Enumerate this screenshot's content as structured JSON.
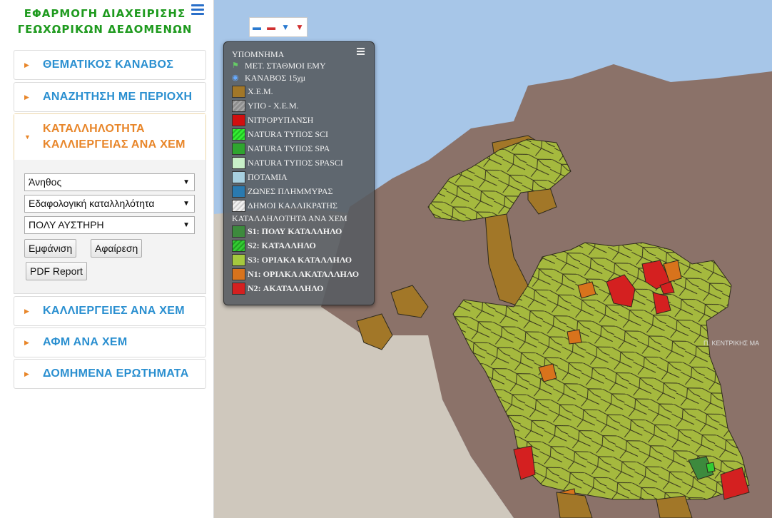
{
  "sidebar": {
    "title_line1": "ΕΦΑΡΜΟΓΗ ΔΙΑΧΕΙΡΙΣΗΣ",
    "title_line2": "ΓΕΩΧΩΡΙΚΩΝ ΔΕΔΟΜΕΝΩΝ",
    "menu_icon": "hamburger-icon",
    "panels": [
      {
        "label": "ΘΕΜΑΤΙΚΟΣ ΚΑΝΑΒΟΣ"
      },
      {
        "label": "ΑΝΑΖΗΤΗΣΗ ΜΕ ΠΕΡΙΟΧΗ"
      },
      {
        "label_line1": "ΚΑΤΑΛΛΗΛΟΤΗΤΑ",
        "label_line2": "ΚΑΛΛΙΕΡΓΕΙΑΣ ΑΝΑ ΧΕΜ"
      },
      {
        "label": "ΚΑΛΛΙΕΡΓΕΙΕΣ ΑΝΑ ΧΕΜ"
      },
      {
        "label": "ΑΦΜ ΑΝΑ ΧΕΜ"
      },
      {
        "label": "ΔΟΜΗΜΕΝΑ ΕΡΩΤΗΜΑΤΑ"
      }
    ],
    "form": {
      "crop_select": "Άνηθος",
      "suitability_select": "Εδαφολογική καταλληλότητα",
      "strictness_select": "ΠΟΛΥ ΑΥΣΤΗΡΗ",
      "show_button": "Εμφάνιση",
      "remove_button": "Αφαίρεση",
      "pdf_button": "PDF Report"
    }
  },
  "map": {
    "region_label": "Π. ΚΕΝΤΡΙΚΗΣ ΜΑ",
    "tools": [
      "zoom-in-icon",
      "zoom-out-icon",
      "filter-icon",
      "clear-filter-icon"
    ],
    "colors": {
      "sea": "#a7c6e8",
      "land_other": "#cfc8bd",
      "region": "#8b7269",
      "s3": "#a5b93e",
      "n1": "#d8731c",
      "n2": "#d42020",
      "xem": "#a27728",
      "s1": "#3d8a3d",
      "s2": "#33cc33"
    }
  },
  "legend": {
    "title": "ΥΠΟΜΝΗΜΑ",
    "items": [
      {
        "label": "ΜΕΤ. ΣΤΑΘΜΟΙ ΕΜΥ",
        "icon": "flag-icon"
      },
      {
        "label": "ΚΑΝΑΒΟΣ 15χμ",
        "icon": "grid-marker-icon"
      },
      {
        "label": "Χ.Ε.Μ.",
        "color": "#a27728"
      },
      {
        "label": "ΥΠΟ - Χ.Ε.Μ.",
        "color": "#8e8e8e"
      },
      {
        "label": "ΝΙΤΡΟΡΥΠΑΝΣΗ",
        "color": "#d10f0f"
      },
      {
        "label": "NATURA ΤΥΠΟΣ SCI",
        "color": "#33ee33"
      },
      {
        "label": "NATURA ΤΥΠΟΣ SPA",
        "color": "#2fa52f"
      },
      {
        "label": "NATURA ΤΥΠΟΣ SPASCI",
        "color": "#c8f0c8"
      },
      {
        "label": "ΠΟΤΑΜΙΑ",
        "color": "#a8d0e0"
      },
      {
        "label": "ΖΩΝΕΣ ΠΛΗΜΜΥΡΑΣ",
        "color": "#2a7ab0"
      },
      {
        "label": "ΔΗΜΟΙ ΚΑΛΛΙΚΡΑΤΗΣ",
        "color": "#e8e8e8"
      }
    ],
    "suitability_title": "ΚΑΤΑΛΛΗΛΟΤΗΤΑ ΑΝΑ ΧΕΜ",
    "suitability": [
      {
        "label": "S1: ΠΟΛΥ ΚΑΤΑΛΛΗΛΟ",
        "color": "#3d8a3d"
      },
      {
        "label": "S2: ΚΑΤΑΛΛΗΛΟ",
        "color": "#33cc33"
      },
      {
        "label": "S3: ΟΡΙΑΚΑ ΚΑΤΑΛΛΗΛΟ",
        "color": "#a5b93e"
      },
      {
        "label": "N1: ΟΡΙΑΚΑ ΑΚΑΤΑΛΛΗΛΟ",
        "color": "#d8731c"
      },
      {
        "label": "N2: ΑΚΑΤΑΛΛΗΛΟ",
        "color": "#d42020"
      }
    ]
  }
}
